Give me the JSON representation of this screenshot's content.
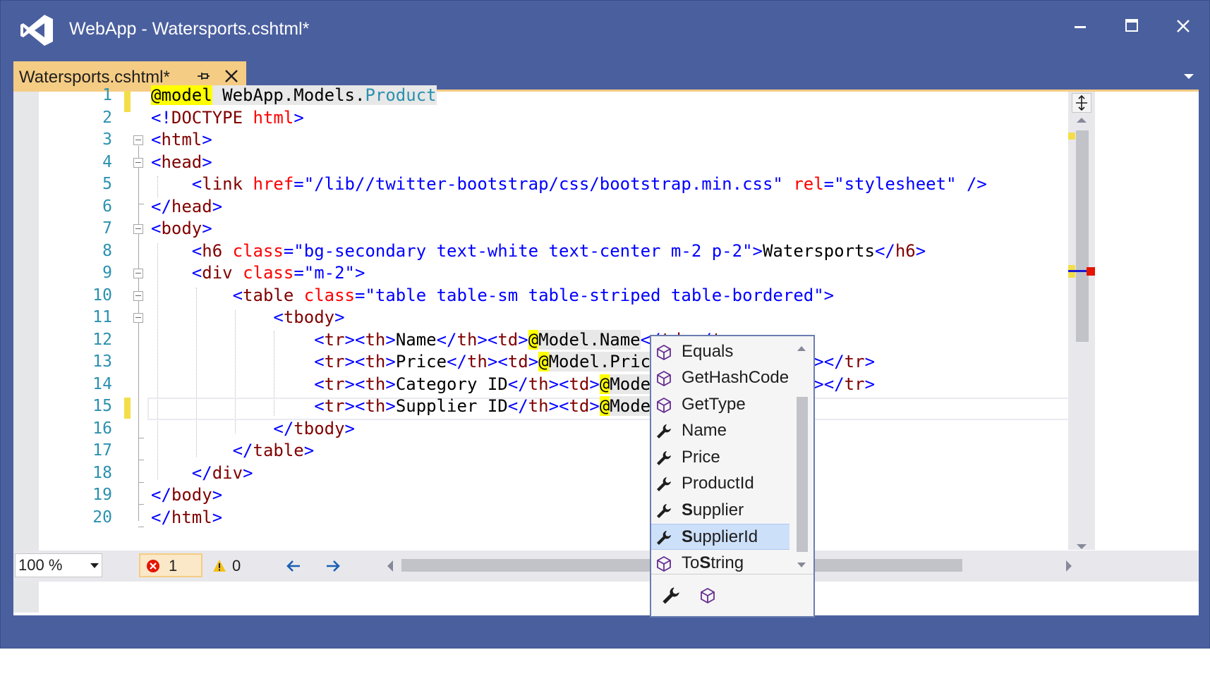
{
  "window": {
    "title": "WebApp - Watersports.cshtml*",
    "accent": "#4a5f9e"
  },
  "tab": {
    "label": "Watersports.cshtml*",
    "pin_icon": "pin-icon",
    "close_icon": "close-icon",
    "color": "#f5cc84"
  },
  "editor": {
    "line_numbers": [
      "1",
      "2",
      "3",
      "4",
      "5",
      "6",
      "7",
      "8",
      "9",
      "10",
      "11",
      "12",
      "13",
      "14",
      "15",
      "16",
      "17",
      "18",
      "19",
      "20"
    ],
    "current_line": 15
  },
  "status": {
    "zoom": "100 %",
    "errors": "1",
    "warnings": "0"
  },
  "completion": {
    "items": [
      {
        "label": "Equals",
        "kind": "method",
        "icon": "method-cube-icon"
      },
      {
        "label": "GetHashCode",
        "kind": "method",
        "icon": "method-cube-icon"
      },
      {
        "label": "GetType",
        "kind": "method",
        "icon": "method-cube-icon"
      },
      {
        "label": "Name",
        "kind": "property",
        "icon": "wrench-icon"
      },
      {
        "label": "Price",
        "kind": "property",
        "icon": "wrench-icon"
      },
      {
        "label": "ProductId",
        "kind": "property",
        "icon": "wrench-icon"
      },
      {
        "label": "Supplier",
        "kind": "property",
        "icon": "wrench-icon",
        "match": "S",
        "rest": "upplier"
      },
      {
        "label": "SupplierId",
        "kind": "property",
        "icon": "wrench-icon",
        "match": "S",
        "rest": "upplierId",
        "selected": true
      },
      {
        "label": "ToString",
        "kind": "method",
        "icon": "method-cube-icon",
        "match": "S",
        "pre": "To",
        "rest": "tring"
      }
    ],
    "filters": [
      "property-filter-wrench-icon",
      "method-filter-cube-icon"
    ]
  }
}
